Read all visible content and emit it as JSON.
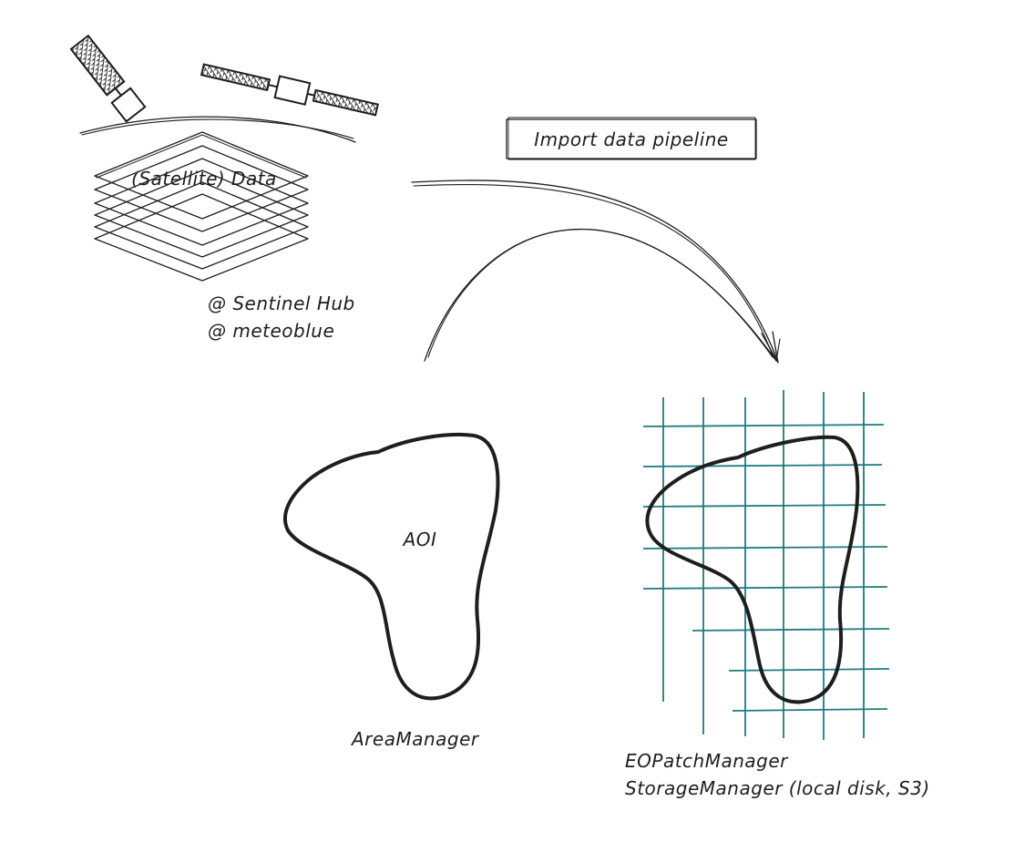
{
  "diagram": {
    "data_stack_label": "(Satellite) Data",
    "sources": [
      "@ Sentinel Hub",
      "@ meteoblue"
    ],
    "pipeline_label": "Import data pipeline",
    "aoi_label": "AOI",
    "area_manager_label": "AreaManager",
    "eopatch_manager_label": "EOPatchManager",
    "storage_manager_label": "StorageManager (local disk, S3)",
    "icons": [
      "satellite-icon",
      "satellite-icon"
    ],
    "colors": {
      "ink": "#1e1e1e",
      "grid": "#1e7b80"
    }
  }
}
